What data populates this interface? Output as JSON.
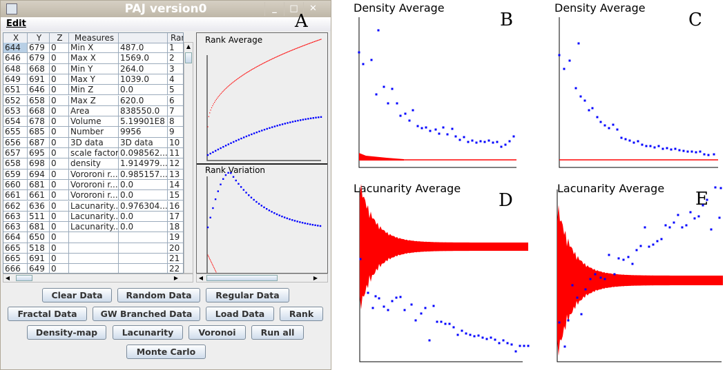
{
  "window": {
    "title": "PAJ version0",
    "menu": [
      "Edit"
    ],
    "controls": {
      "minimize": "_",
      "maximize": "□",
      "close": "✕"
    }
  },
  "table": {
    "columns": [
      "X",
      "Y",
      "Z",
      "Measures",
      "",
      "Ran"
    ],
    "rows": [
      [
        "644",
        "679",
        "0",
        "Min X",
        "487.0",
        "1"
      ],
      [
        "646",
        "679",
        "0",
        "Max X",
        "1569.0",
        "2"
      ],
      [
        "648",
        "668",
        "0",
        "Min Y",
        "264.0",
        "3"
      ],
      [
        "649",
        "691",
        "0",
        "Max Y",
        "1039.0",
        "4"
      ],
      [
        "651",
        "646",
        "0",
        "Min Z",
        "0.0",
        "5"
      ],
      [
        "652",
        "658",
        "0",
        "Max Z",
        "620.0",
        "6"
      ],
      [
        "653",
        "668",
        "0",
        "Area",
        "838550.0",
        "7"
      ],
      [
        "654",
        "678",
        "0",
        "Volume",
        "5.19901E8",
        "8"
      ],
      [
        "655",
        "685",
        "0",
        "Number",
        "9956",
        "9"
      ],
      [
        "656",
        "687",
        "0",
        "3D data",
        "3D data",
        "10"
      ],
      [
        "657",
        "695",
        "0",
        "scale factor",
        "0.098562...",
        "11"
      ],
      [
        "658",
        "698",
        "0",
        "density",
        "1.914979...",
        "12"
      ],
      [
        "659",
        "694",
        "0",
        "Vororoni r...",
        "0.985157...",
        "13"
      ],
      [
        "660",
        "681",
        "0",
        "Vororoni r...",
        "0.0",
        "14"
      ],
      [
        "661",
        "661",
        "0",
        "Vororoni r...",
        "0.0",
        "15"
      ],
      [
        "662",
        "636",
        "0",
        "Lacunarity...",
        "0.976304...",
        "16"
      ],
      [
        "663",
        "511",
        "0",
        "Lacunarity...",
        "0.0",
        "17"
      ],
      [
        "663",
        "681",
        "0",
        "Lacunarity...",
        "0.0",
        "18"
      ],
      [
        "664",
        "650",
        "0",
        "",
        "",
        "19"
      ],
      [
        "665",
        "518",
        "0",
        "",
        "",
        "20"
      ],
      [
        "665",
        "691",
        "0",
        "",
        "",
        "21"
      ],
      [
        "666",
        "649",
        "0",
        "",
        "",
        "22"
      ]
    ]
  },
  "plots": {
    "rank_average": "Rank Average",
    "rank_variation": "Rank Variation"
  },
  "buttons": [
    "Clear Data",
    "Random Data",
    "Regular Data",
    "Fractal Data",
    "GW Branched Data",
    "Load Data",
    "Rank",
    "Density-map",
    "Lacunarity",
    "Voronoi",
    "Run all",
    "Monte Carlo"
  ],
  "panels": {
    "A": "A",
    "B": "B",
    "C": "C",
    "D": "D",
    "E": "E",
    "density_title": "Density Average",
    "lacunarity_title": "Lacunarity Average"
  },
  "colors": {
    "series_blue": "#0000ff",
    "series_red": "#ff0000",
    "button_top": "#fdfeff",
    "button_bottom": "#cfdceb"
  }
}
